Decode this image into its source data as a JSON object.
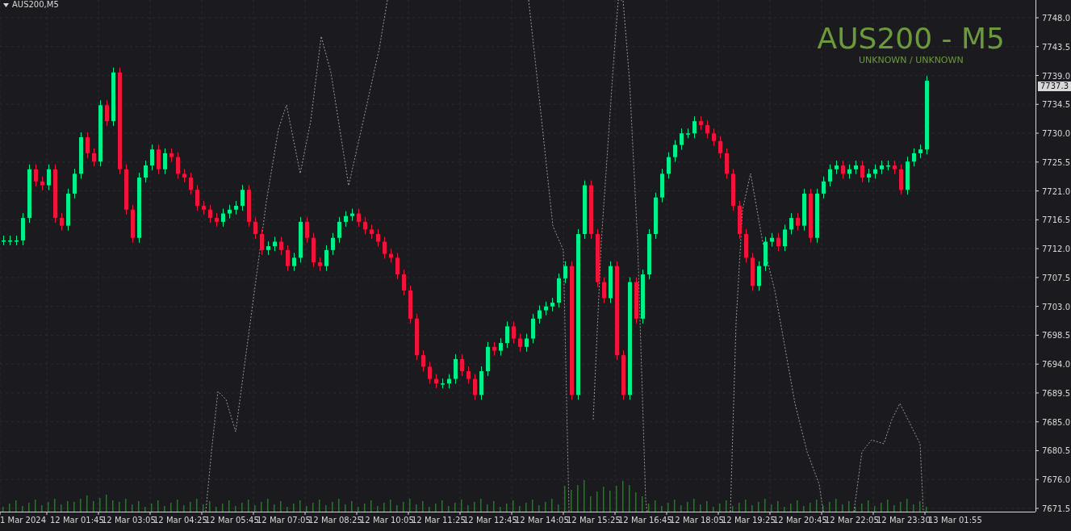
{
  "chart_window": {
    "symbol_label": "AUS200,M5",
    "title": "AUS200 - M5",
    "subtitle": "UNKNOWN / UNKNOWN",
    "last_price": "7737.3"
  },
  "price_axis": {
    "labels": [
      "7748.0",
      "7743.5",
      "7739.0",
      "7734.5",
      "7730.0",
      "7725.5",
      "7721.0",
      "7716.5",
      "7712.0",
      "7707.5",
      "7703.0",
      "7698.5",
      "7694.0",
      "7689.5",
      "7685.0",
      "7680.5",
      "7676.0",
      "7671.5"
    ]
  },
  "time_axis": {
    "labels": [
      "1 Mar 2024",
      "12 Mar 01:45",
      "12 Mar 03:05",
      "12 Mar 04:25",
      "12 Mar 05:45",
      "12 Mar 07:05",
      "12 Mar 08:25",
      "12 Mar 10:05",
      "12 Mar 11:25",
      "12 Mar 12:45",
      "12 Mar 14:05",
      "12 Mar 15:25",
      "12 Mar 16:45",
      "12 Mar 18:05",
      "12 Mar 19:25",
      "12 Mar 20:45",
      "12 Mar 22:05",
      "12 Mar 23:30",
      "13 Mar 01:55"
    ]
  }
}
